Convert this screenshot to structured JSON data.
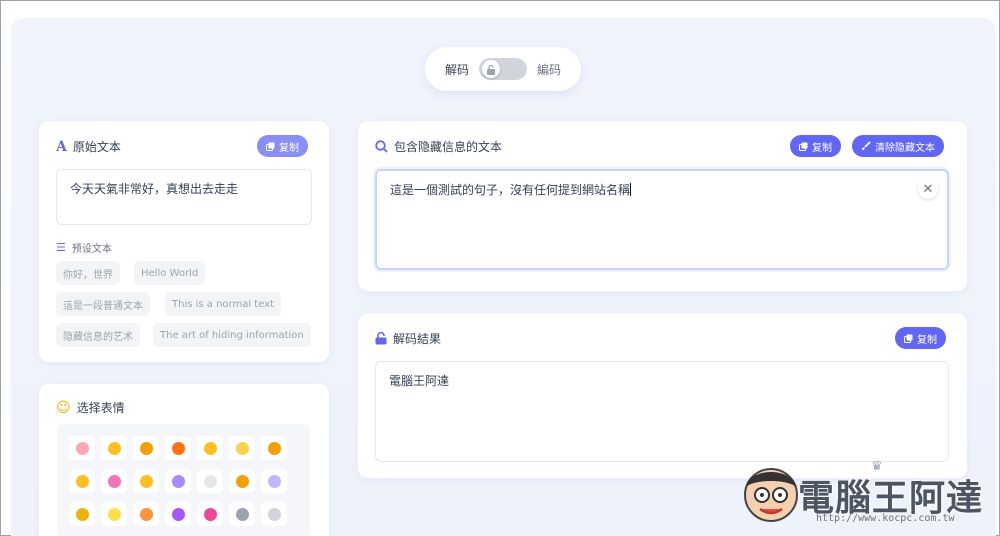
{
  "toggle": {
    "left_label": "解码",
    "right_label": "編码"
  },
  "original": {
    "title": "原始文本",
    "copy_label": "复制",
    "value": "今天天氣非常好，真想出去走走",
    "preset_title": "预设文本",
    "presets": [
      "你好，世界",
      "Hello World",
      "這是一段普通文本",
      "This is a normal text",
      "隐藏信息的艺术",
      "The art of hiding information"
    ]
  },
  "emoji": {
    "title": "选择表情",
    "colors": [
      "#f9a8b4",
      "#fbbf24",
      "#f59e0b",
      "#f97316",
      "#fbbf24",
      "#fcd34d",
      "#f59e0b",
      "#fbbf24",
      "#f472b6",
      "#fbbf24",
      "#a78bfa",
      "#e5e7eb",
      "#f59e0b",
      "#c4b5fd",
      "#eab308",
      "#fde047",
      "#fb923c",
      "#a855f7",
      "#ec4899",
      "#9ca3af",
      "#d1d5db"
    ]
  },
  "hidden": {
    "title": "包含隐藏信息的文本",
    "copy_label": "复制",
    "clear_label": "清除隐藏文本",
    "value": "這是一個測試的句子，沒有任何提到網站名稱"
  },
  "result": {
    "title": "解码結果",
    "copy_label": "复制",
    "value": "電腦王阿達"
  },
  "watermark": {
    "name": "電腦王阿達",
    "url": "http://www.kocpc.com.tw"
  },
  "colors": {
    "accent": "#6366f1",
    "canvas": "#eef2fb"
  }
}
